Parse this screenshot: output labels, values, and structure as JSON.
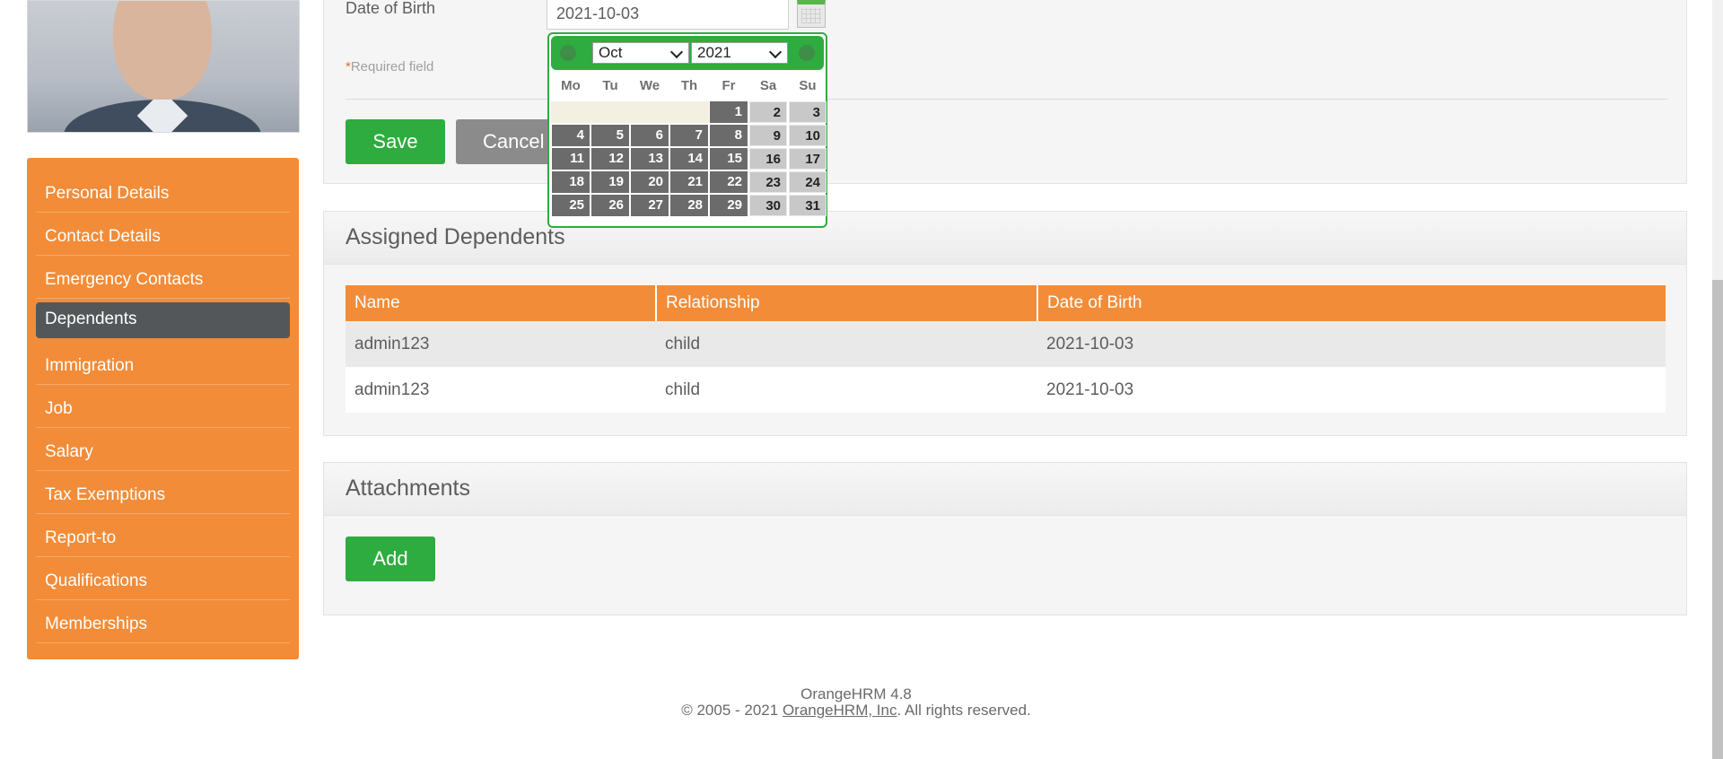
{
  "sidebar": {
    "items": [
      {
        "label": "Personal Details"
      },
      {
        "label": "Contact Details"
      },
      {
        "label": "Emergency Contacts"
      },
      {
        "label": "Dependents",
        "active": true
      },
      {
        "label": "Immigration"
      },
      {
        "label": "Job"
      },
      {
        "label": "Salary"
      },
      {
        "label": "Tax Exemptions"
      },
      {
        "label": "Report-to"
      },
      {
        "label": "Qualifications"
      },
      {
        "label": "Memberships"
      }
    ]
  },
  "form": {
    "dob_label": "Date of Birth",
    "dob_value": "2021-10-03",
    "required_star": "*",
    "required_text": "Required field",
    "save_label": "Save",
    "cancel_label": "Cancel"
  },
  "calendar": {
    "month": "Oct",
    "year": "2021",
    "weekdays": [
      "Mo",
      "Tu",
      "We",
      "Th",
      "Fr",
      "Sa",
      "Su"
    ],
    "leading_blanks": 4,
    "days": [
      "1",
      "2",
      "3",
      "4",
      "5",
      "6",
      "7",
      "8",
      "9",
      "10",
      "11",
      "12",
      "13",
      "14",
      "15",
      "16",
      "17",
      "18",
      "19",
      "20",
      "21",
      "22",
      "23",
      "24",
      "25",
      "26",
      "27",
      "28",
      "29",
      "30",
      "31"
    ]
  },
  "dependents": {
    "title": "Assigned Dependents",
    "columns": [
      "Name",
      "Relationship",
      "Date of Birth"
    ],
    "rows": [
      {
        "name": "admin123",
        "relationship": "child",
        "dob": "2021-10-03"
      },
      {
        "name": "admin123",
        "relationship": "child",
        "dob": "2021-10-03"
      }
    ]
  },
  "attachments": {
    "title": "Attachments",
    "add_label": "Add"
  },
  "footer": {
    "version": "OrangeHRM 4.8",
    "copyright_prefix": "© 2005 - 2021 ",
    "company_link": "OrangeHRM, Inc",
    "copyright_suffix": ". All rights reserved."
  },
  "colors": {
    "brand_orange": "#f28c38",
    "success_green": "#2fac3f",
    "active_nav": "#54575a"
  }
}
